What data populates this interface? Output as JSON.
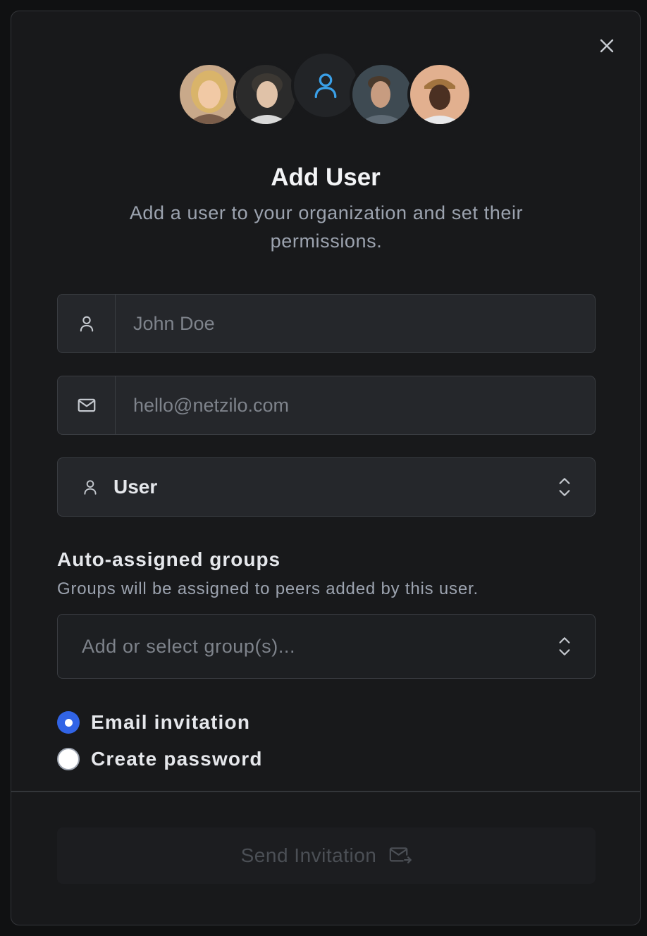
{
  "modal": {
    "title": "Add User",
    "subtitle": "Add a user to your organization and set their permissions.",
    "close_icon": "close-icon"
  },
  "avatars": [
    {
      "name": "avatar-woman-blonde"
    },
    {
      "name": "avatar-man-curly"
    },
    {
      "name": "avatar-placeholder-user-icon"
    },
    {
      "name": "avatar-man-profile"
    },
    {
      "name": "avatar-man-cap"
    }
  ],
  "form": {
    "name_field": {
      "placeholder": "John Doe",
      "value": "",
      "icon": "user-icon"
    },
    "email_field": {
      "placeholder": "hello@netzilo.com",
      "value": "",
      "icon": "mail-icon"
    },
    "role_select": {
      "value": "User",
      "icon": "user-icon"
    }
  },
  "groups": {
    "heading": "Auto-assigned groups",
    "help": "Groups will be assigned to peers added by this user.",
    "placeholder": "Add or select group(s)..."
  },
  "invite_method": {
    "options": [
      {
        "label": "Email invitation",
        "checked": true
      },
      {
        "label": "Create password",
        "checked": false
      }
    ]
  },
  "footer": {
    "send_label": "Send Invitation",
    "send_icon": "send-mail-icon",
    "enabled": false
  },
  "colors": {
    "accent_blue": "#3164e6",
    "icon_blue": "#3aa0e8",
    "modal_bg": "#18191b",
    "field_bg": "#25272b"
  }
}
